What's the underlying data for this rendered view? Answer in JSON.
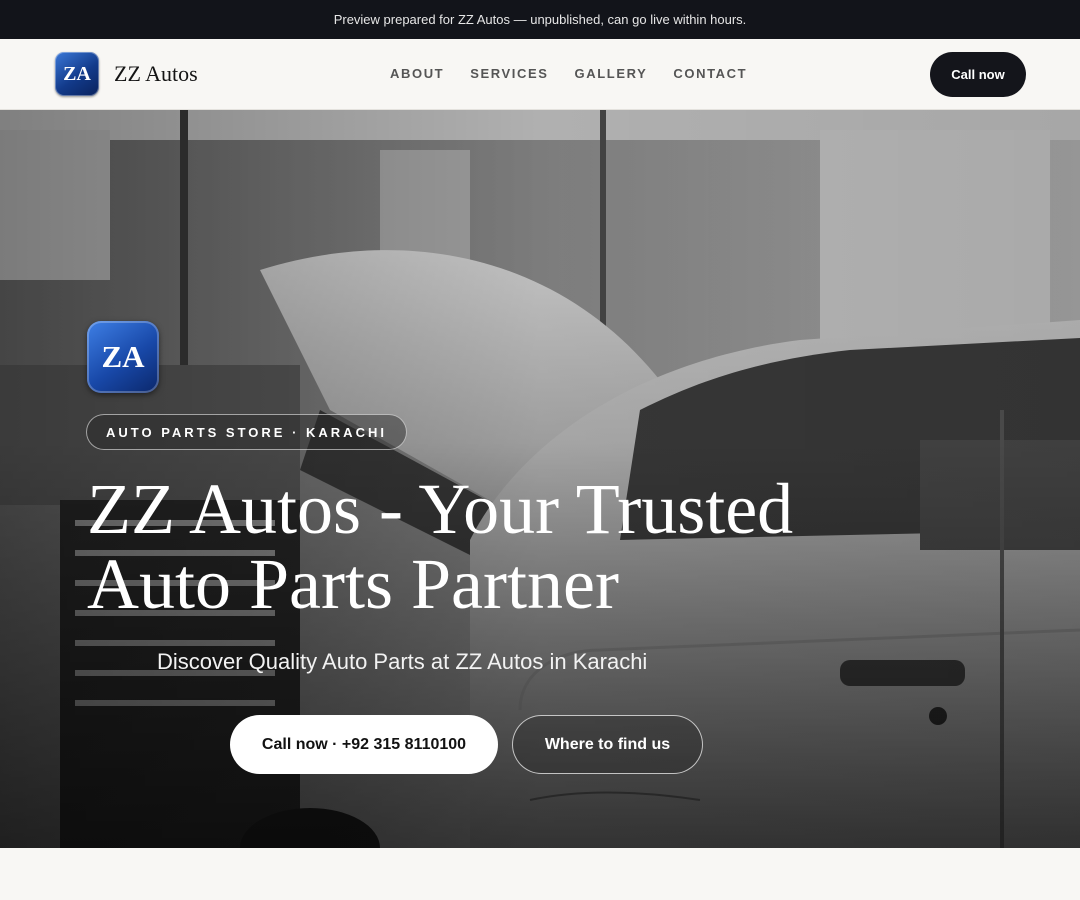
{
  "preview_bar": {
    "text": "Preview prepared for ZZ Autos — unpublished, can go live within hours."
  },
  "header": {
    "logo_text": "ZA",
    "brand": "ZZ Autos",
    "nav": [
      "ABOUT",
      "SERVICES",
      "GALLERY",
      "CONTACT"
    ],
    "cta": "Call now"
  },
  "hero": {
    "logo_text": "ZA",
    "tag": "AUTO PARTS STORE · KARACHI",
    "title_line1": "ZZ Autos - Your Trusted",
    "title_line2": "Auto Parts Partner",
    "subtitle": "Discover Quality Auto Parts at ZZ Autos in Karachi",
    "primary_button": "Call now · +92 315 8110100",
    "secondary_button": "Where to find us",
    "background_image": "garage-car-photo"
  },
  "colors": {
    "dark": "#12141a",
    "page_bg": "#f8f7f4",
    "logo_blue": "#1848a8"
  }
}
